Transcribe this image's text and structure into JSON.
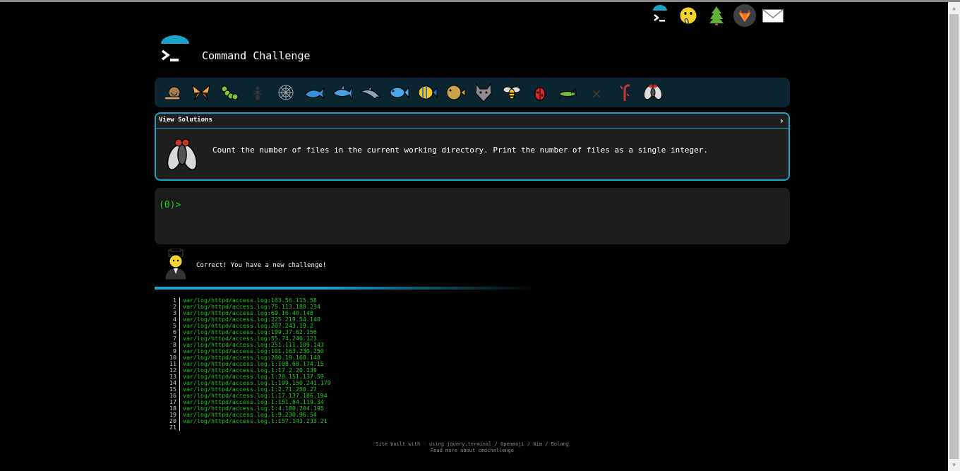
{
  "site": {
    "title": "Command Challenge"
  },
  "top_icons": [
    "terminal-icon",
    "mouth-hand-icon",
    "pine-tree-icon",
    "gitlab-icon",
    "envelope-icon"
  ],
  "animals": [
    "snail",
    "butterfly",
    "caterpillar",
    "ant",
    "spider-web",
    "whale",
    "shark",
    "dolphin",
    "fish",
    "tropical-fish",
    "pufferfish",
    "wolf",
    "bee",
    "ladybug",
    "cricket",
    "spider",
    "scorpion",
    "fly"
  ],
  "challenge": {
    "view_solutions_label": "View Solutions",
    "text": "Count the number of files in the current working directory. Print the number of files as a single integer."
  },
  "terminal": {
    "prompt": "(0)>"
  },
  "status": {
    "message": "Correct! You have a new challenge!"
  },
  "progress": {
    "fraction": 0.45
  },
  "output_lines": [
    {
      "n": "1",
      "text": "var/log/httpd/access.log:163.56.115.58"
    },
    {
      "n": "2",
      "text": "var/log/httpd/access.log:75.113.188.234"
    },
    {
      "n": "3",
      "text": "var/log/httpd/access.log:69.16.40.148"
    },
    {
      "n": "4",
      "text": "var/log/httpd/access.log:225.219.54.140"
    },
    {
      "n": "5",
      "text": "var/log/httpd/access.log:207.243.19.2"
    },
    {
      "n": "6",
      "text": "var/log/httpd/access.log:199.37.62.156"
    },
    {
      "n": "7",
      "text": "var/log/httpd/access.log:55.74.240.123"
    },
    {
      "n": "8",
      "text": "var/log/httpd/access.log:251.111.109.143"
    },
    {
      "n": "9",
      "text": "var/log/httpd/access.log:101.163.230.250"
    },
    {
      "n": "10",
      "text": "var/log/httpd/access.log:200.19.168.148"
    },
    {
      "n": "11",
      "text": "var/log/httpd/access.log.1:108.68.174.15"
    },
    {
      "n": "12",
      "text": "var/log/httpd/access.log.1:17.2.20.139"
    },
    {
      "n": "13",
      "text": "var/log/httpd/access.log.1:28.151.137.59"
    },
    {
      "n": "14",
      "text": "var/log/httpd/access.log.1:199.150.241.179"
    },
    {
      "n": "15",
      "text": "var/log/httpd/access.log.1:2.71.250.27"
    },
    {
      "n": "16",
      "text": "var/log/httpd/access.log.1:17.137.186.194"
    },
    {
      "n": "17",
      "text": "var/log/httpd/access.log.1:151.84.119.34"
    },
    {
      "n": "18",
      "text": "var/log/httpd/access.log.1:4.180.204.195"
    },
    {
      "n": "19",
      "text": "var/log/httpd/access.log.1:9.230.96.54"
    },
    {
      "n": "20",
      "text": "var/log/httpd/access.log.1:157.143.233.21"
    },
    {
      "n": "21",
      "text": ""
    }
  ],
  "footer": {
    "line1": "Site built with ♡ using jquery.terminal / Openmoji / Nim / Golang",
    "line2": "Read more about cmdchallenge"
  },
  "colors": {
    "accent": "#1aa3c9",
    "prompt_green": "#1fcf1f",
    "panel_bg": "#1f1f1f",
    "animal_bar_bg": "#0b2530"
  }
}
